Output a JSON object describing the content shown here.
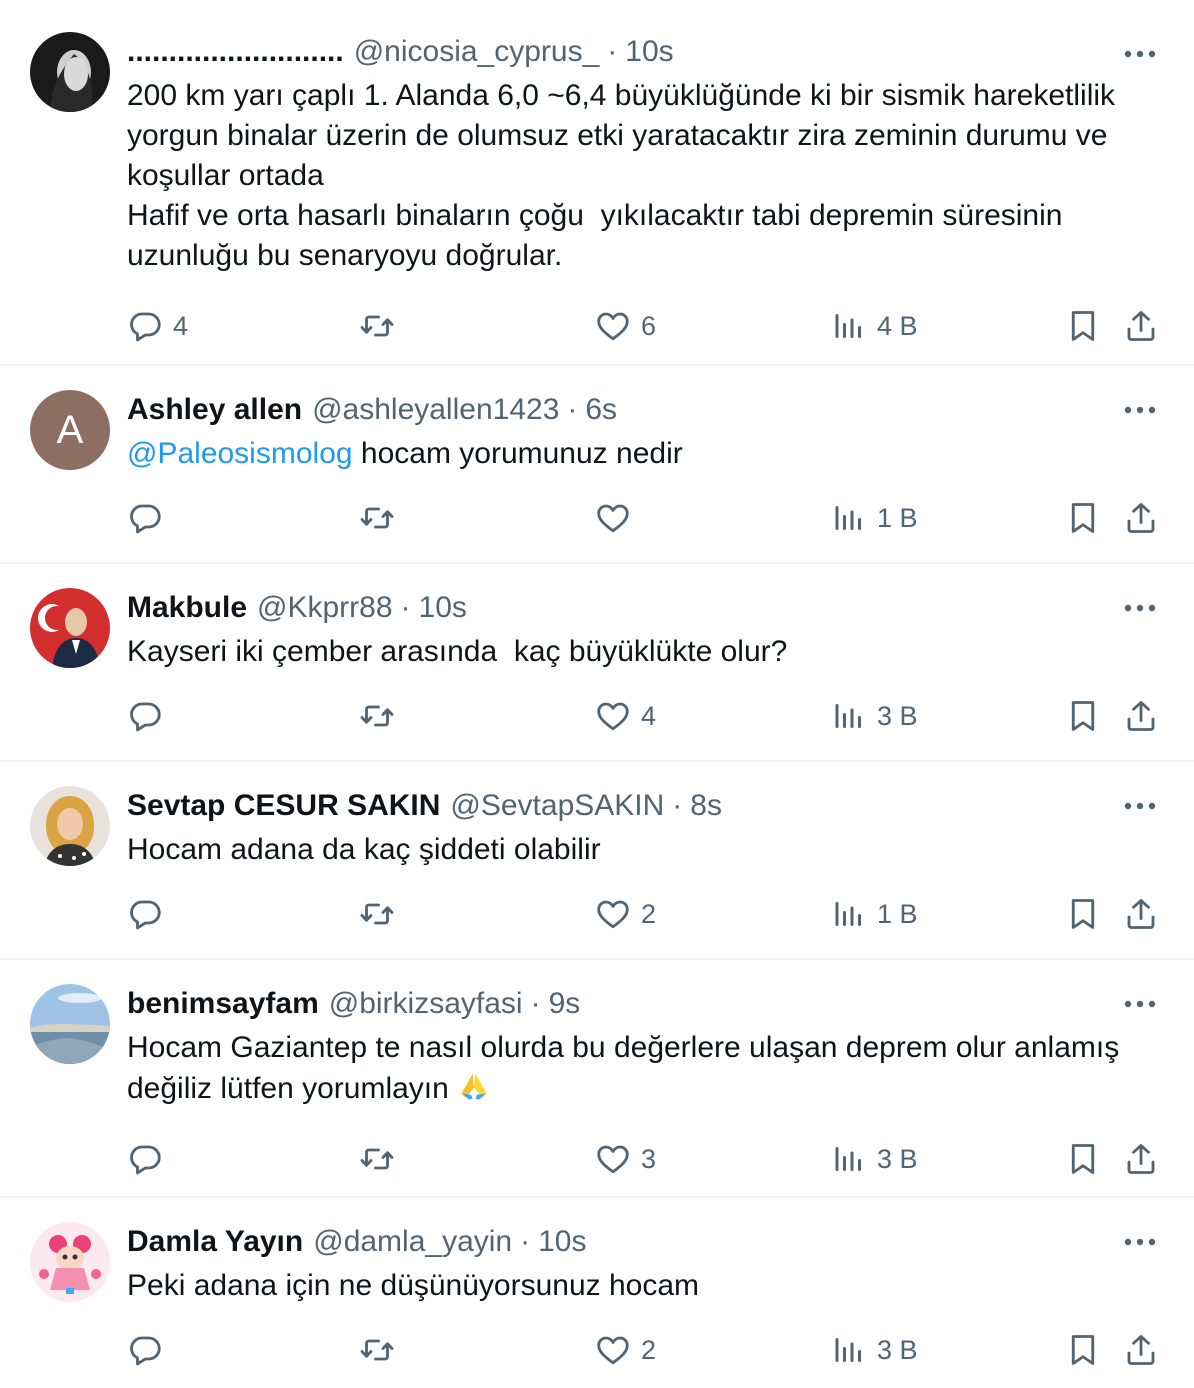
{
  "tweets": [
    {
      "name": "..........................",
      "handle": "@nicosia_cyprus_",
      "time": "10s",
      "text": "200 km yarı çaplı 1. Alanda 6,0 ~6,4 büyüklüğünde ki bir sismik hareketlilik yorgun binalar üzerin de olumsuz etki yaratacaktır zira zeminin durumu ve koşullar ortada\nHafif ve orta hasarlı binaların çoğu  yıkılacaktır tabi depremin süresinin uzunluğu bu senaryoyu doğrular.",
      "replies": "4",
      "retweets": "",
      "likes": "6",
      "views": "4 B"
    },
    {
      "name": "Ashley allen",
      "handle": "@ashleyallen1423",
      "time": "6s",
      "avatar_letter": "A",
      "mention": "@Paleosismolog",
      "text": " hocam yorumunuz nedir",
      "replies": "",
      "retweets": "",
      "likes": "",
      "views": "1 B"
    },
    {
      "name": "Makbule",
      "handle": "@Kkprr88",
      "time": "10s",
      "text": "Kayseri iki çember arasında  kaç büyüklükte olur?",
      "replies": "",
      "retweets": "",
      "likes": "4",
      "views": "3 B"
    },
    {
      "name": "Sevtap CESUR SAKIN",
      "handle": "@SevtapSAKIN",
      "time": "8s",
      "text": "Hocam adana da kaç şiddeti olabilir",
      "replies": "",
      "retweets": "",
      "likes": "2",
      "views": "1 B"
    },
    {
      "name": "benimsayfam",
      "handle": "@birkizsayfasi",
      "time": "9s",
      "text": "Hocam Gaziantep te nasıl olurda bu değerlere ulaşan deprem olur anlamış değiliz lütfen yorumlayın ",
      "replies": "",
      "retweets": "",
      "likes": "3",
      "views": "3 B"
    },
    {
      "name": "Damla Yayın",
      "handle": "@damla_yayin",
      "time": "10s",
      "text": "Peki adana için ne düşünüyorsunuz hocam",
      "replies": "",
      "retweets": "",
      "likes": "2",
      "views": "3 B"
    }
  ],
  "separator": "·",
  "icons": {
    "reply": "reply-icon",
    "retweet": "retweet-icon",
    "like": "like-icon",
    "views": "views-icon",
    "bookmark": "bookmark-icon",
    "share": "share-icon",
    "more": "more-icon"
  },
  "colors": {
    "text": "#0f1419",
    "secondary": "#536471",
    "link": "#1d9bf0",
    "divider": "#eff3f4"
  }
}
